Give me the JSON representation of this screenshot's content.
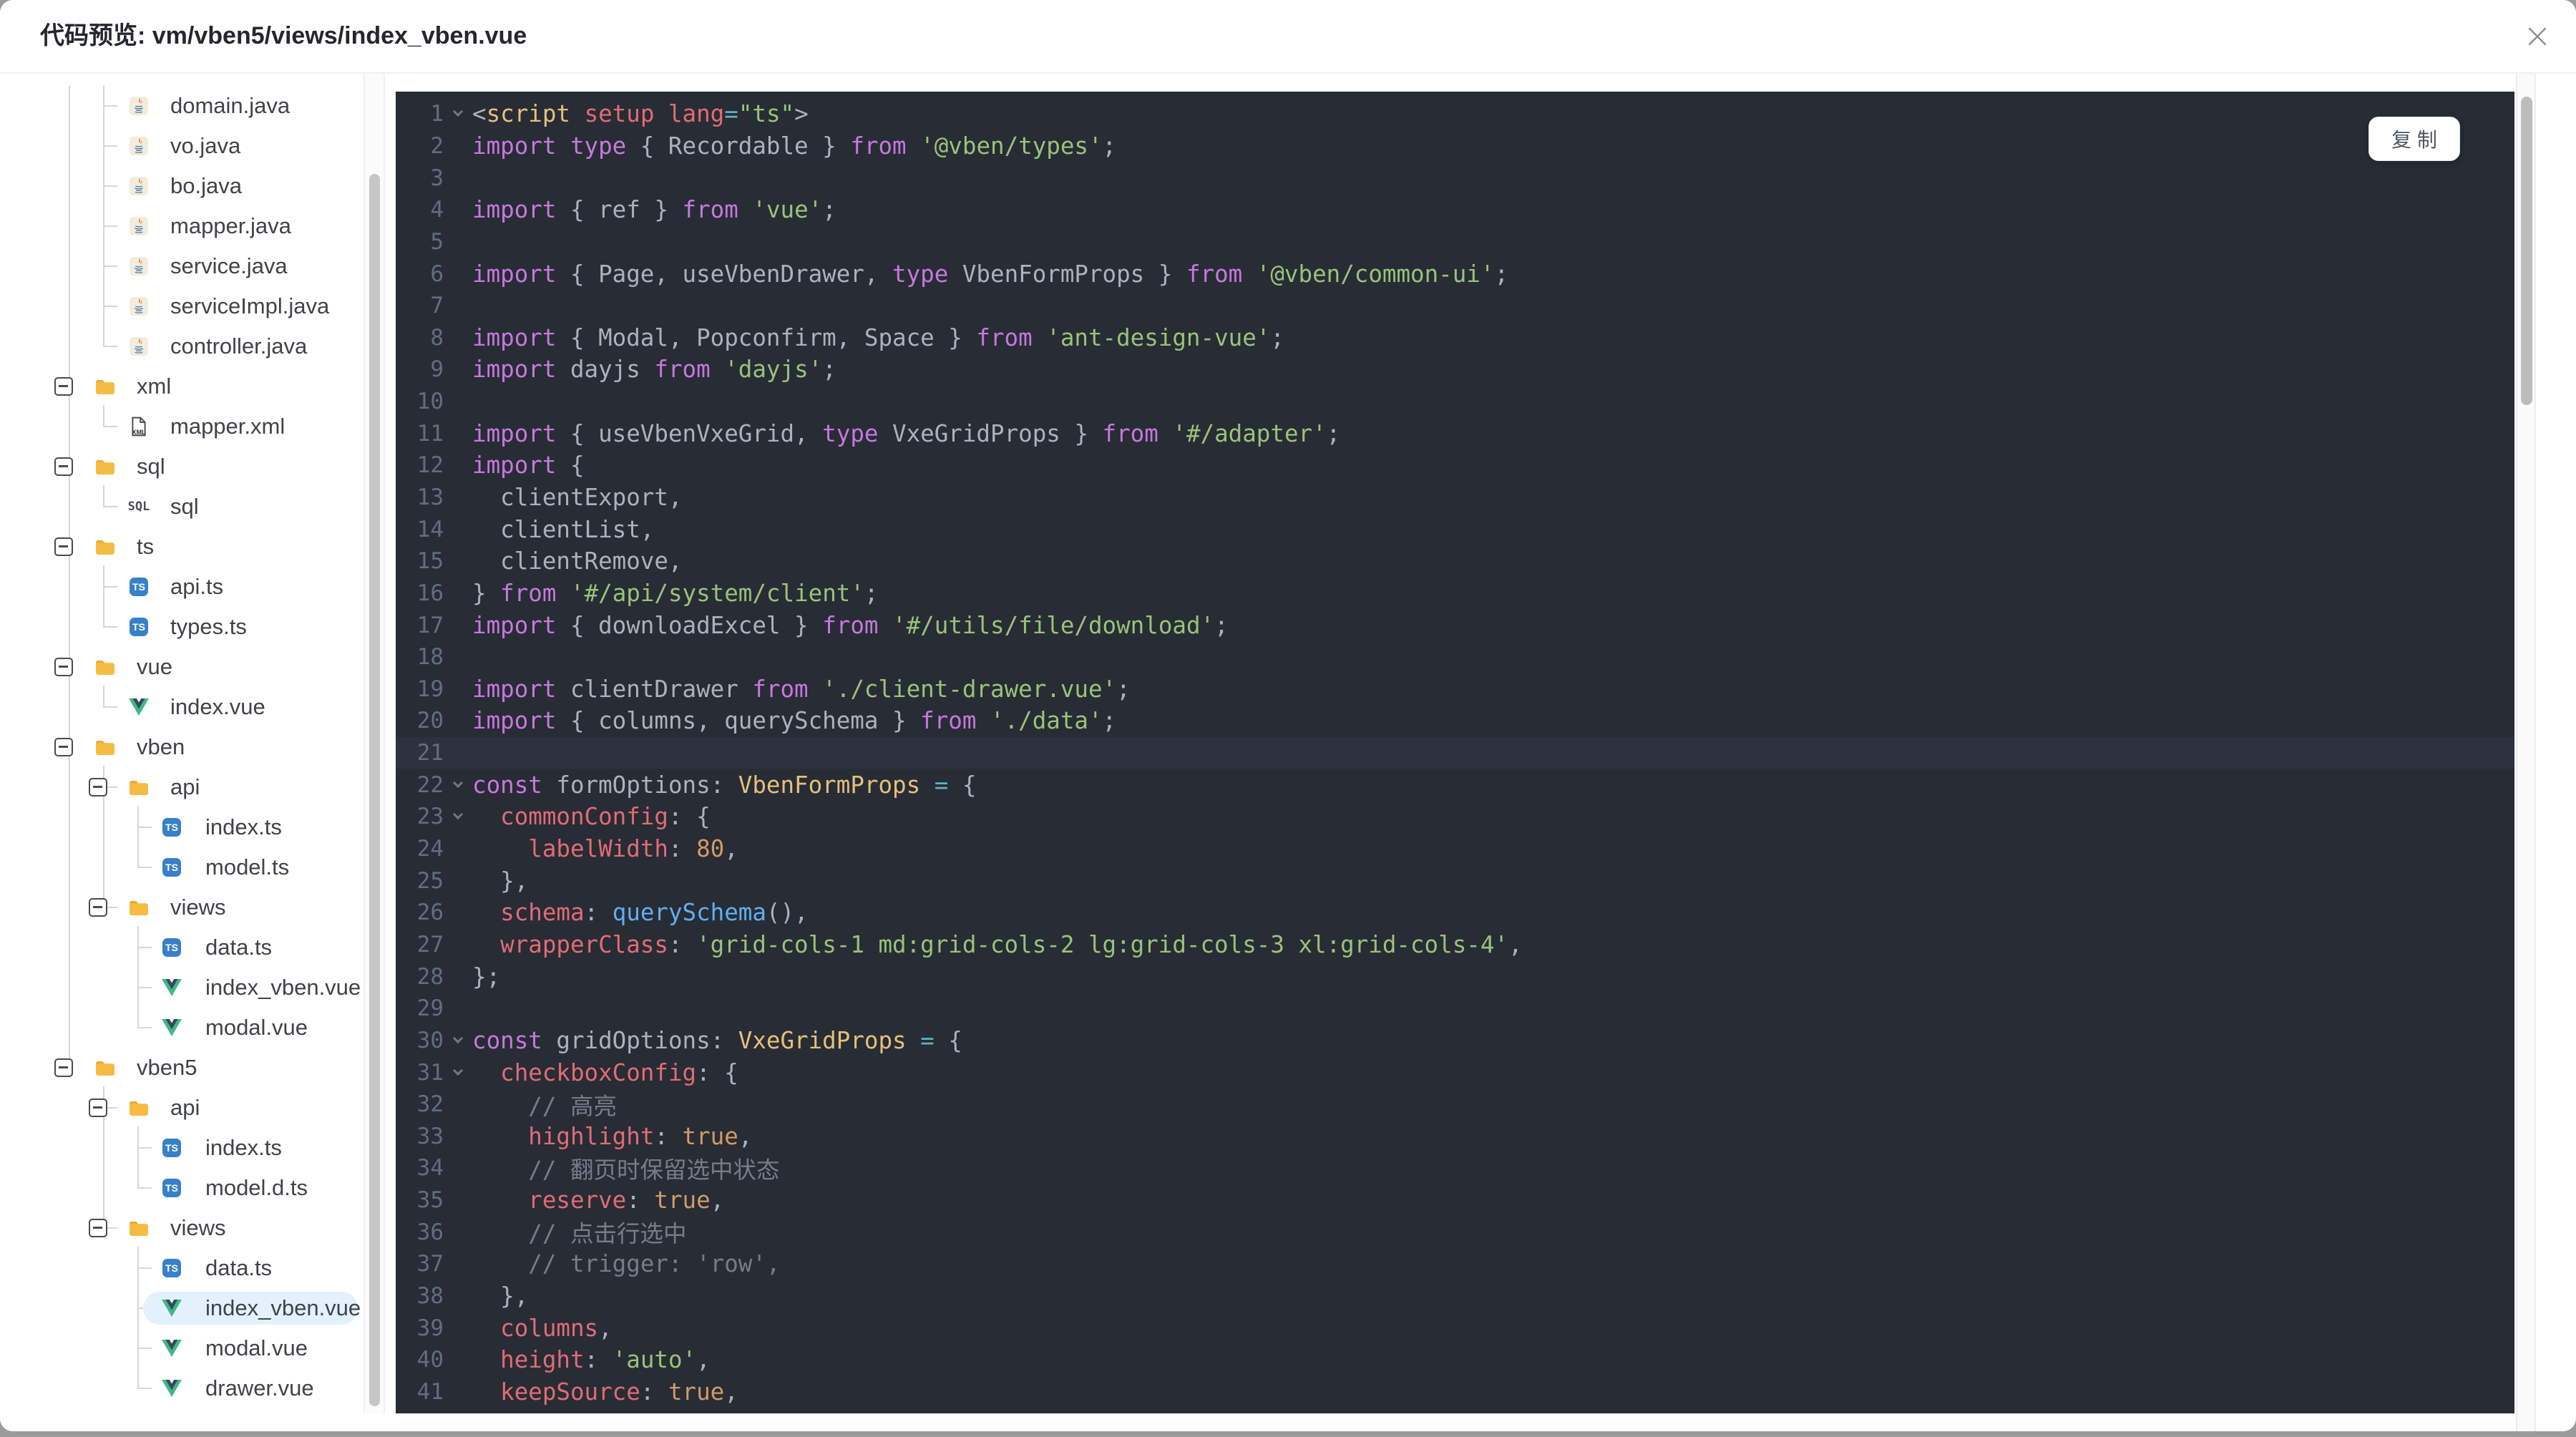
{
  "modal": {
    "title": "代码预览: vm/vben5/views/index_vben.vue",
    "close_icon": "×"
  },
  "copy_button": {
    "label": "复 制"
  },
  "colors": {
    "editor_bg": "#282c35",
    "current_line_bg": "#2d323e",
    "line_number": "#626d83",
    "keyword": "#c678dd",
    "string": "#98c379",
    "property": "#e06c75",
    "type": "#e5c07b",
    "function": "#61afef",
    "number": "#d19a66",
    "operator": "#56b6c2",
    "comment": "#747d8b",
    "default_text": "#abb2bf",
    "selected_row_bg": "#e2f1fd",
    "folder_icon": "#f5bc41",
    "ts_icon_bg": "#3880c8",
    "vue_green": "#41b883",
    "vue_dark": "#35495e",
    "connector": "#d7d7d7"
  },
  "tree": {
    "rows": [
      {
        "label": "domain.java",
        "icon": "java",
        "depth": 1
      },
      {
        "label": "vo.java",
        "icon": "java",
        "depth": 1
      },
      {
        "label": "bo.java",
        "icon": "java",
        "depth": 1
      },
      {
        "label": "mapper.java",
        "icon": "java",
        "depth": 1
      },
      {
        "label": "service.java",
        "icon": "java",
        "depth": 1
      },
      {
        "label": "serviceImpl.java",
        "icon": "java",
        "depth": 1
      },
      {
        "label": "controller.java",
        "icon": "java",
        "depth": 1
      },
      {
        "label": "xml",
        "icon": "folder",
        "depth": 0,
        "expanded": true
      },
      {
        "label": "mapper.xml",
        "icon": "xml",
        "depth": 1
      },
      {
        "label": "sql",
        "icon": "folder",
        "depth": 0,
        "expanded": true
      },
      {
        "label": "sql",
        "icon": "sql",
        "depth": 1
      },
      {
        "label": "ts",
        "icon": "folder",
        "depth": 0,
        "expanded": true
      },
      {
        "label": "api.ts",
        "icon": "ts",
        "depth": 1
      },
      {
        "label": "types.ts",
        "icon": "ts",
        "depth": 1
      },
      {
        "label": "vue",
        "icon": "folder",
        "depth": 0,
        "expanded": true
      },
      {
        "label": "index.vue",
        "icon": "vue",
        "depth": 1
      },
      {
        "label": "vben",
        "icon": "folder",
        "depth": 0,
        "expanded": true
      },
      {
        "label": "api",
        "icon": "folder",
        "depth": 1,
        "expanded": true
      },
      {
        "label": "index.ts",
        "icon": "ts",
        "depth": 2
      },
      {
        "label": "model.ts",
        "icon": "ts",
        "depth": 2
      },
      {
        "label": "views",
        "icon": "folder",
        "depth": 1,
        "expanded": true
      },
      {
        "label": "data.ts",
        "icon": "ts",
        "depth": 2
      },
      {
        "label": "index_vben.vue",
        "icon": "vue",
        "depth": 2
      },
      {
        "label": "modal.vue",
        "icon": "vue",
        "depth": 2
      },
      {
        "label": "vben5",
        "icon": "folder",
        "depth": 0,
        "expanded": true
      },
      {
        "label": "api",
        "icon": "folder",
        "depth": 1,
        "expanded": true
      },
      {
        "label": "index.ts",
        "icon": "ts",
        "depth": 2
      },
      {
        "label": "model.d.ts",
        "icon": "ts",
        "depth": 2
      },
      {
        "label": "views",
        "icon": "folder",
        "depth": 1,
        "expanded": true
      },
      {
        "label": "data.ts",
        "icon": "ts",
        "depth": 2
      },
      {
        "label": "index_vben.vue",
        "icon": "vue",
        "depth": 2,
        "selected": true
      },
      {
        "label": "modal.vue",
        "icon": "vue",
        "depth": 2
      },
      {
        "label": "drawer.vue",
        "icon": "vue",
        "depth": 2
      }
    ]
  },
  "code": {
    "current_line": 21,
    "fold_lines": [
      1,
      22,
      23,
      30,
      31
    ],
    "lines": [
      {
        "n": 1,
        "segs": [
          [
            "<",
            "def"
          ],
          [
            "script",
            "typ"
          ],
          [
            " ",
            "def"
          ],
          [
            "setup",
            "prop"
          ],
          [
            " ",
            "def"
          ],
          [
            "lang",
            "prop"
          ],
          [
            "=",
            "op"
          ],
          [
            "\"ts\"",
            "str"
          ],
          [
            ">",
            "def"
          ]
        ]
      },
      {
        "n": 2,
        "segs": [
          [
            "import type",
            "kw"
          ],
          [
            " { Recordable } ",
            "def"
          ],
          [
            "from",
            "kw"
          ],
          [
            " ",
            "def"
          ],
          [
            "'@vben/types'",
            "str"
          ],
          [
            ";",
            "def"
          ]
        ]
      },
      {
        "n": 3,
        "segs": []
      },
      {
        "n": 4,
        "segs": [
          [
            "import",
            "kw"
          ],
          [
            " { ref } ",
            "def"
          ],
          [
            "from",
            "kw"
          ],
          [
            " ",
            "def"
          ],
          [
            "'vue'",
            "str"
          ],
          [
            ";",
            "def"
          ]
        ]
      },
      {
        "n": 5,
        "segs": []
      },
      {
        "n": 6,
        "segs": [
          [
            "import",
            "kw"
          ],
          [
            " { Page, useVbenDrawer, ",
            "def"
          ],
          [
            "type",
            "kw"
          ],
          [
            " VbenFormProps } ",
            "def"
          ],
          [
            "from",
            "kw"
          ],
          [
            " ",
            "def"
          ],
          [
            "'@vben/common-ui'",
            "str"
          ],
          [
            ";",
            "def"
          ]
        ]
      },
      {
        "n": 7,
        "segs": []
      },
      {
        "n": 8,
        "segs": [
          [
            "import",
            "kw"
          ],
          [
            " { Modal, Popconfirm, Space } ",
            "def"
          ],
          [
            "from",
            "kw"
          ],
          [
            " ",
            "def"
          ],
          [
            "'ant-design-vue'",
            "str"
          ],
          [
            ";",
            "def"
          ]
        ]
      },
      {
        "n": 9,
        "segs": [
          [
            "import",
            "kw"
          ],
          [
            " dayjs ",
            "def"
          ],
          [
            "from",
            "kw"
          ],
          [
            " ",
            "def"
          ],
          [
            "'dayjs'",
            "str"
          ],
          [
            ";",
            "def"
          ]
        ]
      },
      {
        "n": 10,
        "segs": []
      },
      {
        "n": 11,
        "segs": [
          [
            "import",
            "kw"
          ],
          [
            " { useVbenVxeGrid, ",
            "def"
          ],
          [
            "type",
            "kw"
          ],
          [
            " VxeGridProps } ",
            "def"
          ],
          [
            "from",
            "kw"
          ],
          [
            " ",
            "def"
          ],
          [
            "'#/adapter'",
            "str"
          ],
          [
            ";",
            "def"
          ]
        ]
      },
      {
        "n": 12,
        "segs": [
          [
            "import",
            "kw"
          ],
          [
            " {",
            "def"
          ]
        ]
      },
      {
        "n": 13,
        "segs": [
          [
            "  clientExport,",
            "def"
          ]
        ]
      },
      {
        "n": 14,
        "segs": [
          [
            "  clientList,",
            "def"
          ]
        ]
      },
      {
        "n": 15,
        "segs": [
          [
            "  clientRemove,",
            "def"
          ]
        ]
      },
      {
        "n": 16,
        "segs": [
          [
            "} ",
            "def"
          ],
          [
            "from",
            "kw"
          ],
          [
            " ",
            "def"
          ],
          [
            "'#/api/system/client'",
            "str"
          ],
          [
            ";",
            "def"
          ]
        ]
      },
      {
        "n": 17,
        "segs": [
          [
            "import",
            "kw"
          ],
          [
            " { downloadExcel } ",
            "def"
          ],
          [
            "from",
            "kw"
          ],
          [
            " ",
            "def"
          ],
          [
            "'#/utils/file/download'",
            "str"
          ],
          [
            ";",
            "def"
          ]
        ]
      },
      {
        "n": 18,
        "segs": []
      },
      {
        "n": 19,
        "segs": [
          [
            "import",
            "kw"
          ],
          [
            " clientDrawer ",
            "def"
          ],
          [
            "from",
            "kw"
          ],
          [
            " ",
            "def"
          ],
          [
            "'./client-drawer.vue'",
            "str"
          ],
          [
            ";",
            "def"
          ]
        ]
      },
      {
        "n": 20,
        "segs": [
          [
            "import",
            "kw"
          ],
          [
            " { columns, querySchema } ",
            "def"
          ],
          [
            "from",
            "kw"
          ],
          [
            " ",
            "def"
          ],
          [
            "'./data'",
            "str"
          ],
          [
            ";",
            "def"
          ]
        ]
      },
      {
        "n": 21,
        "segs": []
      },
      {
        "n": 22,
        "segs": [
          [
            "const",
            "kw"
          ],
          [
            " formOptions: ",
            "def"
          ],
          [
            "VbenFormProps",
            "typ"
          ],
          [
            " ",
            "def"
          ],
          [
            "=",
            "op"
          ],
          [
            " {",
            "def"
          ]
        ]
      },
      {
        "n": 23,
        "segs": [
          [
            "  ",
            "def"
          ],
          [
            "commonConfig",
            "prop"
          ],
          [
            ": {",
            "def"
          ]
        ]
      },
      {
        "n": 24,
        "segs": [
          [
            "    ",
            "def"
          ],
          [
            "labelWidth",
            "prop"
          ],
          [
            ": ",
            "def"
          ],
          [
            "80",
            "num"
          ],
          [
            ",",
            "def"
          ]
        ]
      },
      {
        "n": 25,
        "segs": [
          [
            "  },",
            "def"
          ]
        ]
      },
      {
        "n": 26,
        "segs": [
          [
            "  ",
            "def"
          ],
          [
            "schema",
            "prop"
          ],
          [
            ": ",
            "def"
          ],
          [
            "querySchema",
            "fn"
          ],
          [
            "(),",
            "def"
          ]
        ]
      },
      {
        "n": 27,
        "segs": [
          [
            "  ",
            "def"
          ],
          [
            "wrapperClass",
            "prop"
          ],
          [
            ": ",
            "def"
          ],
          [
            "'grid-cols-1 md:grid-cols-2 lg:grid-cols-3 xl:grid-cols-4'",
            "str"
          ],
          [
            ",",
            "def"
          ]
        ]
      },
      {
        "n": 28,
        "segs": [
          [
            "};",
            "def"
          ]
        ]
      },
      {
        "n": 29,
        "segs": []
      },
      {
        "n": 30,
        "segs": [
          [
            "const",
            "kw"
          ],
          [
            " gridOptions: ",
            "def"
          ],
          [
            "VxeGridProps",
            "typ"
          ],
          [
            " ",
            "def"
          ],
          [
            "=",
            "op"
          ],
          [
            " {",
            "def"
          ]
        ]
      },
      {
        "n": 31,
        "segs": [
          [
            "  ",
            "def"
          ],
          [
            "checkboxConfig",
            "prop"
          ],
          [
            ": {",
            "def"
          ]
        ]
      },
      {
        "n": 32,
        "segs": [
          [
            "    ",
            "def"
          ],
          [
            "// 高亮",
            "com"
          ]
        ]
      },
      {
        "n": 33,
        "segs": [
          [
            "    ",
            "def"
          ],
          [
            "highlight",
            "prop"
          ],
          [
            ": ",
            "def"
          ],
          [
            "true",
            "num"
          ],
          [
            ",",
            "def"
          ]
        ]
      },
      {
        "n": 34,
        "segs": [
          [
            "    ",
            "def"
          ],
          [
            "// 翻页时保留选中状态",
            "com"
          ]
        ]
      },
      {
        "n": 35,
        "segs": [
          [
            "    ",
            "def"
          ],
          [
            "reserve",
            "prop"
          ],
          [
            ": ",
            "def"
          ],
          [
            "true",
            "num"
          ],
          [
            ",",
            "def"
          ]
        ]
      },
      {
        "n": 36,
        "segs": [
          [
            "    ",
            "def"
          ],
          [
            "// 点击行选中",
            "com"
          ]
        ]
      },
      {
        "n": 37,
        "segs": [
          [
            "    ",
            "def"
          ],
          [
            "// trigger: 'row',",
            "com"
          ]
        ]
      },
      {
        "n": 38,
        "segs": [
          [
            "  },",
            "def"
          ]
        ]
      },
      {
        "n": 39,
        "segs": [
          [
            "  ",
            "def"
          ],
          [
            "columns",
            "prop"
          ],
          [
            ",",
            "def"
          ]
        ]
      },
      {
        "n": 40,
        "segs": [
          [
            "  ",
            "def"
          ],
          [
            "height",
            "prop"
          ],
          [
            ": ",
            "def"
          ],
          [
            "'auto'",
            "str"
          ],
          [
            ",",
            "def"
          ]
        ]
      },
      {
        "n": 41,
        "segs": [
          [
            "  ",
            "def"
          ],
          [
            "keepSource",
            "prop"
          ],
          [
            ": ",
            "def"
          ],
          [
            "true",
            "num"
          ],
          [
            ",",
            "def"
          ]
        ]
      }
    ]
  }
}
